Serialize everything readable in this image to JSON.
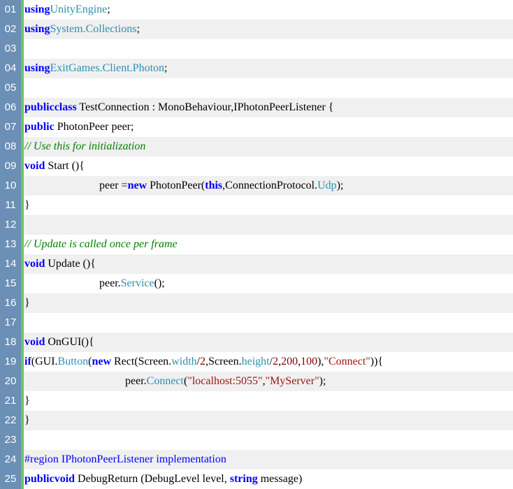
{
  "editor": {
    "colors": {
      "gutter_bg": "#6b8fb5",
      "change_bar": "#6ac56a",
      "alt_row": "#f0f0f0",
      "keyword": "#0000ff",
      "type": "#2b91af",
      "comment": "#008000",
      "string": "#a31515"
    },
    "lines": [
      {
        "n": "01",
        "indent": 0,
        "tokens": [
          [
            "kw",
            "using"
          ],
          [
            "type",
            "UnityEngine"
          ],
          [
            "plain",
            ";"
          ]
        ]
      },
      {
        "n": "02",
        "indent": 0,
        "tokens": [
          [
            "kw",
            "using"
          ],
          [
            "type",
            "System.Collections"
          ],
          [
            "plain",
            ";"
          ]
        ]
      },
      {
        "n": "03",
        "indent": 0,
        "tokens": []
      },
      {
        "n": "04",
        "indent": 0,
        "tokens": [
          [
            "kw",
            "using"
          ],
          [
            "type",
            "ExitGames.Client.Photon"
          ],
          [
            "plain",
            ";"
          ]
        ]
      },
      {
        "n": "05",
        "indent": 0,
        "tokens": []
      },
      {
        "n": "06",
        "indent": 0,
        "tokens": [
          [
            "kw",
            "public"
          ],
          [
            "kw",
            "class"
          ],
          [
            "plain",
            " TestConnection : MonoBehaviour,IPhotonPeerListener {"
          ]
        ]
      },
      {
        "n": "07",
        "indent": 0,
        "tokens": [
          [
            "kw",
            "public"
          ],
          [
            "plain",
            " PhotonPeer peer;"
          ]
        ]
      },
      {
        "n": "08",
        "indent": 0,
        "tokens": [
          [
            "cmt",
            "// Use this for initialization"
          ]
        ]
      },
      {
        "n": "09",
        "indent": 0,
        "tokens": [
          [
            "kw",
            "void"
          ],
          [
            "plain",
            " Start ()"
          ],
          [
            "plain",
            "{"
          ]
        ]
      },
      {
        "n": "10",
        "indent": 107,
        "tokens": [
          [
            "plain",
            "peer ="
          ],
          [
            "kw",
            "new"
          ],
          [
            "plain",
            " PhotonPeer("
          ],
          [
            "kw",
            "this"
          ],
          [
            "plain",
            ",ConnectionProtocol."
          ],
          [
            "type",
            "Udp"
          ],
          [
            "plain",
            ");"
          ]
        ]
      },
      {
        "n": "11",
        "indent": 0,
        "tokens": [
          [
            "plain",
            "}"
          ]
        ]
      },
      {
        "n": "12",
        "indent": 0,
        "tokens": []
      },
      {
        "n": "13",
        "indent": 0,
        "tokens": [
          [
            "cmt",
            "// Update is called once per frame"
          ]
        ]
      },
      {
        "n": "14",
        "indent": 0,
        "tokens": [
          [
            "kw",
            "void"
          ],
          [
            "plain",
            " Update ()"
          ],
          [
            "plain",
            "{"
          ]
        ]
      },
      {
        "n": "15",
        "indent": 107,
        "tokens": [
          [
            "plain",
            "peer."
          ],
          [
            "type",
            "Service"
          ],
          [
            "plain",
            "();"
          ]
        ]
      },
      {
        "n": "16",
        "indent": 0,
        "tokens": [
          [
            "plain",
            "}"
          ]
        ]
      },
      {
        "n": "17",
        "indent": 0,
        "tokens": []
      },
      {
        "n": "18",
        "indent": 0,
        "tokens": [
          [
            "kw",
            "void"
          ],
          [
            "plain",
            " OnGUI()"
          ],
          [
            "plain",
            "{"
          ]
        ]
      },
      {
        "n": "19",
        "indent": 0,
        "tokens": [
          [
            "kw",
            "if"
          ],
          [
            "plain",
            "(GUI."
          ],
          [
            "type",
            "Button"
          ],
          [
            "plain",
            "("
          ],
          [
            "kw",
            "new"
          ],
          [
            "plain",
            " Rect(Screen."
          ],
          [
            "type",
            "width"
          ],
          [
            "plain",
            "/"
          ],
          [
            "num",
            "2"
          ],
          [
            "plain",
            ",Screen."
          ],
          [
            "type",
            "height"
          ],
          [
            "plain",
            "/"
          ],
          [
            "num",
            "2"
          ],
          [
            "plain",
            ","
          ],
          [
            "num",
            "200"
          ],
          [
            "plain",
            ","
          ],
          [
            "num",
            "100"
          ],
          [
            "plain",
            "),"
          ],
          [
            "str",
            "\"Connect\""
          ],
          [
            "plain",
            "))"
          ],
          [
            "plain",
            "{"
          ]
        ]
      },
      {
        "n": "20",
        "indent": 144,
        "tokens": [
          [
            "plain",
            "peer."
          ],
          [
            "type",
            "Connect"
          ],
          [
            "plain",
            "("
          ],
          [
            "str",
            "\"localhost:5055\""
          ],
          [
            "plain",
            ","
          ],
          [
            "str",
            "\"MyServer\""
          ],
          [
            "plain",
            ");"
          ]
        ]
      },
      {
        "n": "21",
        "indent": 0,
        "tokens": [
          [
            "plain",
            "}"
          ]
        ]
      },
      {
        "n": "22",
        "indent": 0,
        "tokens": [
          [
            "plain",
            "}"
          ]
        ]
      },
      {
        "n": "23",
        "indent": 0,
        "tokens": []
      },
      {
        "n": "24",
        "indent": 0,
        "tokens": [
          [
            "pp",
            "#region IPhotonPeerListener implementation"
          ]
        ]
      },
      {
        "n": "25",
        "indent": 0,
        "tokens": [
          [
            "kw",
            "public"
          ],
          [
            "kw",
            "void"
          ],
          [
            "plain",
            " DebugReturn (DebugLevel level, "
          ],
          [
            "kw",
            "string"
          ],
          [
            "plain",
            " message)"
          ]
        ]
      }
    ]
  }
}
